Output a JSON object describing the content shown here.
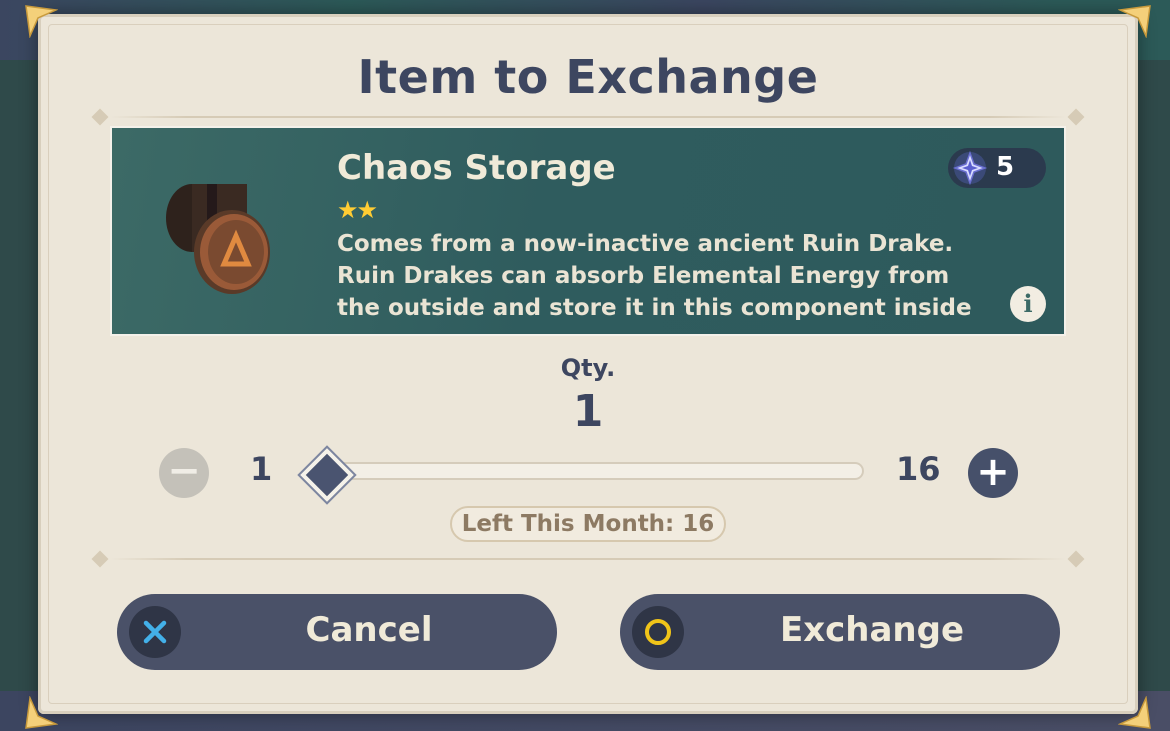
{
  "dialog": {
    "title": "Item to Exchange"
  },
  "item": {
    "name": "Chaos Storage",
    "rarity_stars": "★★",
    "description": "Comes from a now-inactive ancient Ruin Drake. Ruin Drakes can absorb Elemental Energy from the outside and store it in this component inside",
    "cost": "5",
    "cost_icon": "starglitter-icon",
    "info_icon": "i"
  },
  "quantity": {
    "label": "Qty.",
    "value": "1",
    "min": "1",
    "max": "16",
    "minus_symbol": "−",
    "plus_symbol": "+",
    "slider_fraction": 0.0
  },
  "left_this_month": "Left This Month: 16",
  "buttons": {
    "cancel": "Cancel",
    "exchange": "Exchange"
  },
  "colors": {
    "dialog_bg": "#ece6d9",
    "card_bg": "#2f5c5e",
    "text_dark": "#3d4660",
    "button_bg": "#4a5168",
    "star": "#ffcc33",
    "cancel_icon": "#43b0e8",
    "exchange_icon": "#f0c419"
  }
}
